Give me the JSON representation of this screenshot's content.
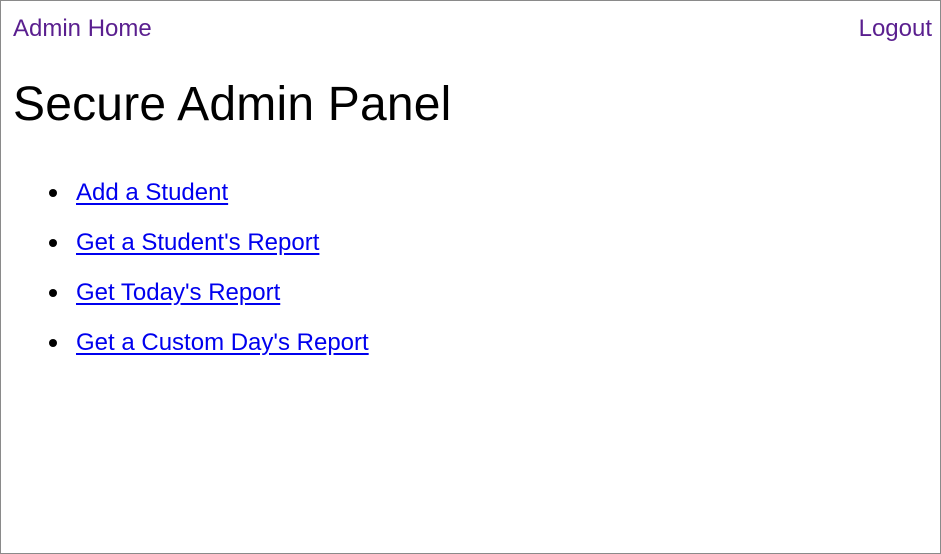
{
  "nav": {
    "home_label": "Admin Home",
    "logout_label": "Logout"
  },
  "page": {
    "title": "Secure Admin Panel"
  },
  "menu": {
    "items": [
      {
        "label": "Add a Student"
      },
      {
        "label": "Get a Student's Report"
      },
      {
        "label": "Get Today's Report"
      },
      {
        "label": "Get a Custom Day's Report"
      }
    ]
  },
  "colors": {
    "visited_link": "#5a1f8f",
    "link": "#0000ee",
    "text": "#000000",
    "background": "#ffffff"
  }
}
